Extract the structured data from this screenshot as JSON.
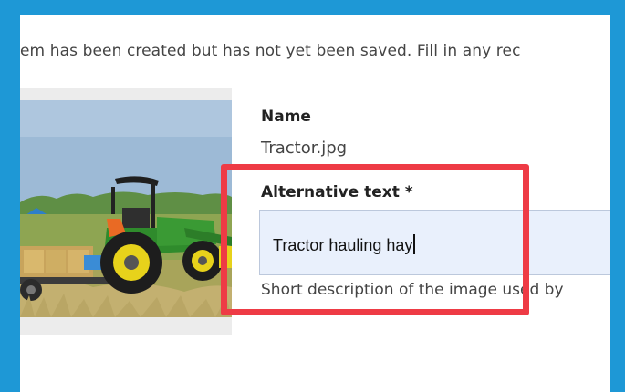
{
  "status_message": "em has been created but has not yet been saved. Fill in any rec",
  "media": {
    "thumbnail_subject": "tractor hauling hay bales in a field"
  },
  "fields": {
    "name_label": "Name",
    "name_value": "Tractor.jpg",
    "alt_label": "Alternative text *",
    "alt_value": "Tractor hauling hay",
    "alt_help": "Short description of the image used by"
  },
  "colors": {
    "frame_border": "#1e98d6",
    "highlight_box": "#ee3b45",
    "input_background": "#e9f0fc"
  }
}
